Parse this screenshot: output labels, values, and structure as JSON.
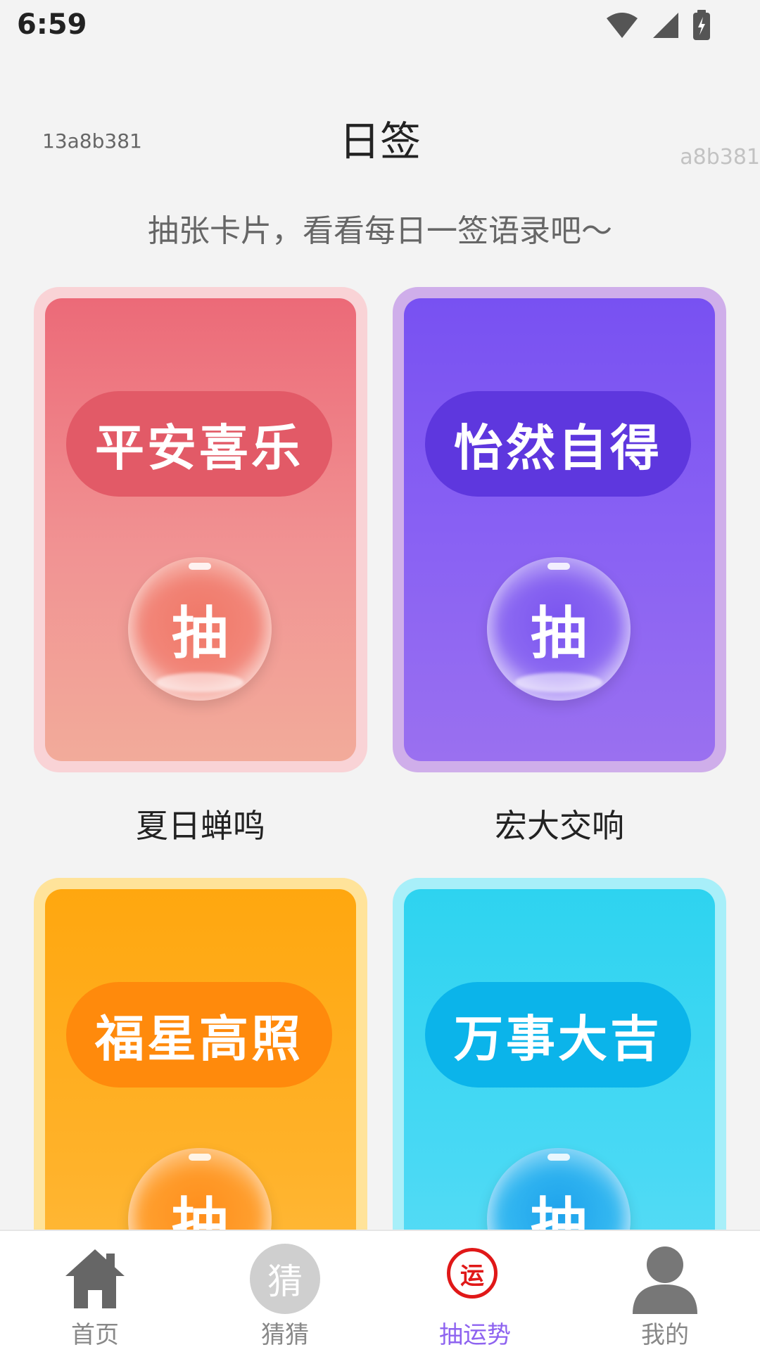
{
  "status": {
    "time": "6:59"
  },
  "header": {
    "left_id": "13a8b381",
    "title": "日签",
    "right_id": "a8b381"
  },
  "subtitle": "抽张卡片，看看每日一签语录吧～",
  "cards": [
    {
      "phrase": "平安喜乐",
      "button": "抽",
      "label": "夏日蝉鸣"
    },
    {
      "phrase": "怡然自得",
      "button": "抽",
      "label": "宏大交响"
    },
    {
      "phrase": "福星高照",
      "button": "抽",
      "label": ""
    },
    {
      "phrase": "万事大吉",
      "button": "抽",
      "label": ""
    }
  ],
  "tabs": [
    {
      "label": "首页",
      "icon": "home-icon"
    },
    {
      "label": "猜猜",
      "icon": "guess-icon",
      "icon_text": "猜"
    },
    {
      "label": "抽运势",
      "icon": "fortune-icon",
      "icon_text": "运"
    },
    {
      "label": "我的",
      "icon": "profile-icon"
    }
  ],
  "colors": {
    "accent": "#8e63f0",
    "red_card": "#ec6b7a",
    "purple_card": "#7b52f1",
    "orange_card": "#ffaa10",
    "cyan_card": "#2ed3f0"
  }
}
